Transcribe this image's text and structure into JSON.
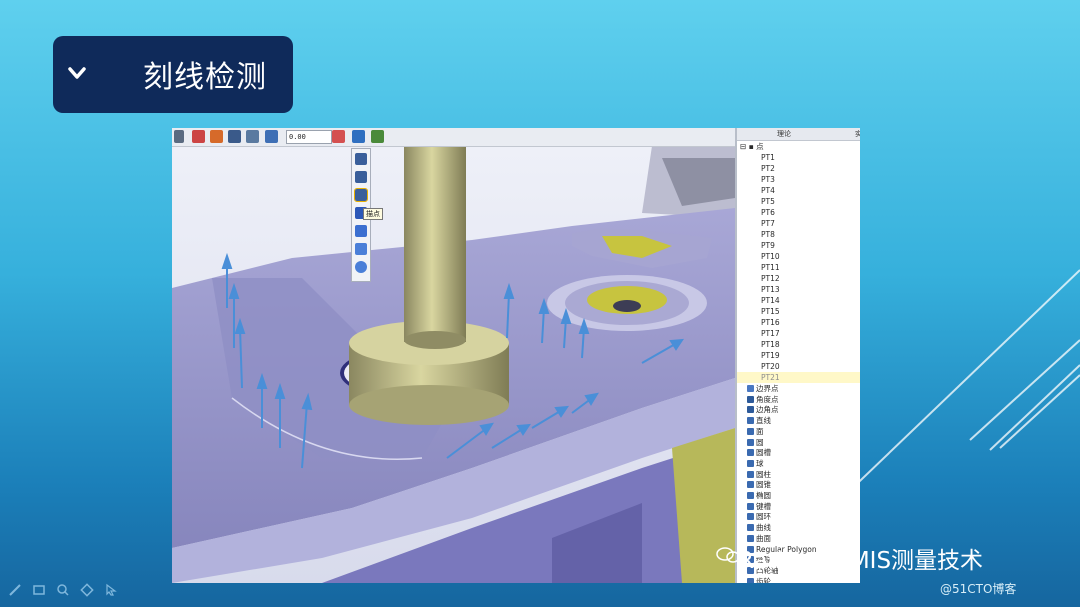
{
  "slide": {
    "title": "刻线检测",
    "watermark": "RationalDMIS测量技术",
    "credit": "@51CTO博客"
  },
  "toolbar": {
    "value_input": "0.00",
    "tooltip": "描点"
  },
  "tree": {
    "column_header": "理论",
    "column_header_2": "实",
    "root_label": "点",
    "points": [
      "PT1",
      "PT2",
      "PT3",
      "PT4",
      "PT5",
      "PT6",
      "PT7",
      "PT8",
      "PT9",
      "PT10",
      "PT11",
      "PT12",
      "PT13",
      "PT14",
      "PT15",
      "PT16",
      "PT17",
      "PT18",
      "PT19",
      "PT20",
      "PT21"
    ],
    "features": [
      "边界点",
      "角度点",
      "边角点",
      "直线",
      "面",
      "圆",
      "圆槽",
      "球",
      "圆柱",
      "圆锥",
      "椭圆",
      "键槽",
      "圆环",
      "曲线",
      "曲面",
      "Regular Polygon",
      "缝隙",
      "凸轮轴",
      "齿轮"
    ]
  },
  "colors": {
    "title_box": "#0f2a5a",
    "part_surface": "#9c9bcf",
    "cylinder": "#cfcc94",
    "vector_arrow": "#4a8fd8",
    "tree_selected": "#fff8c8"
  }
}
